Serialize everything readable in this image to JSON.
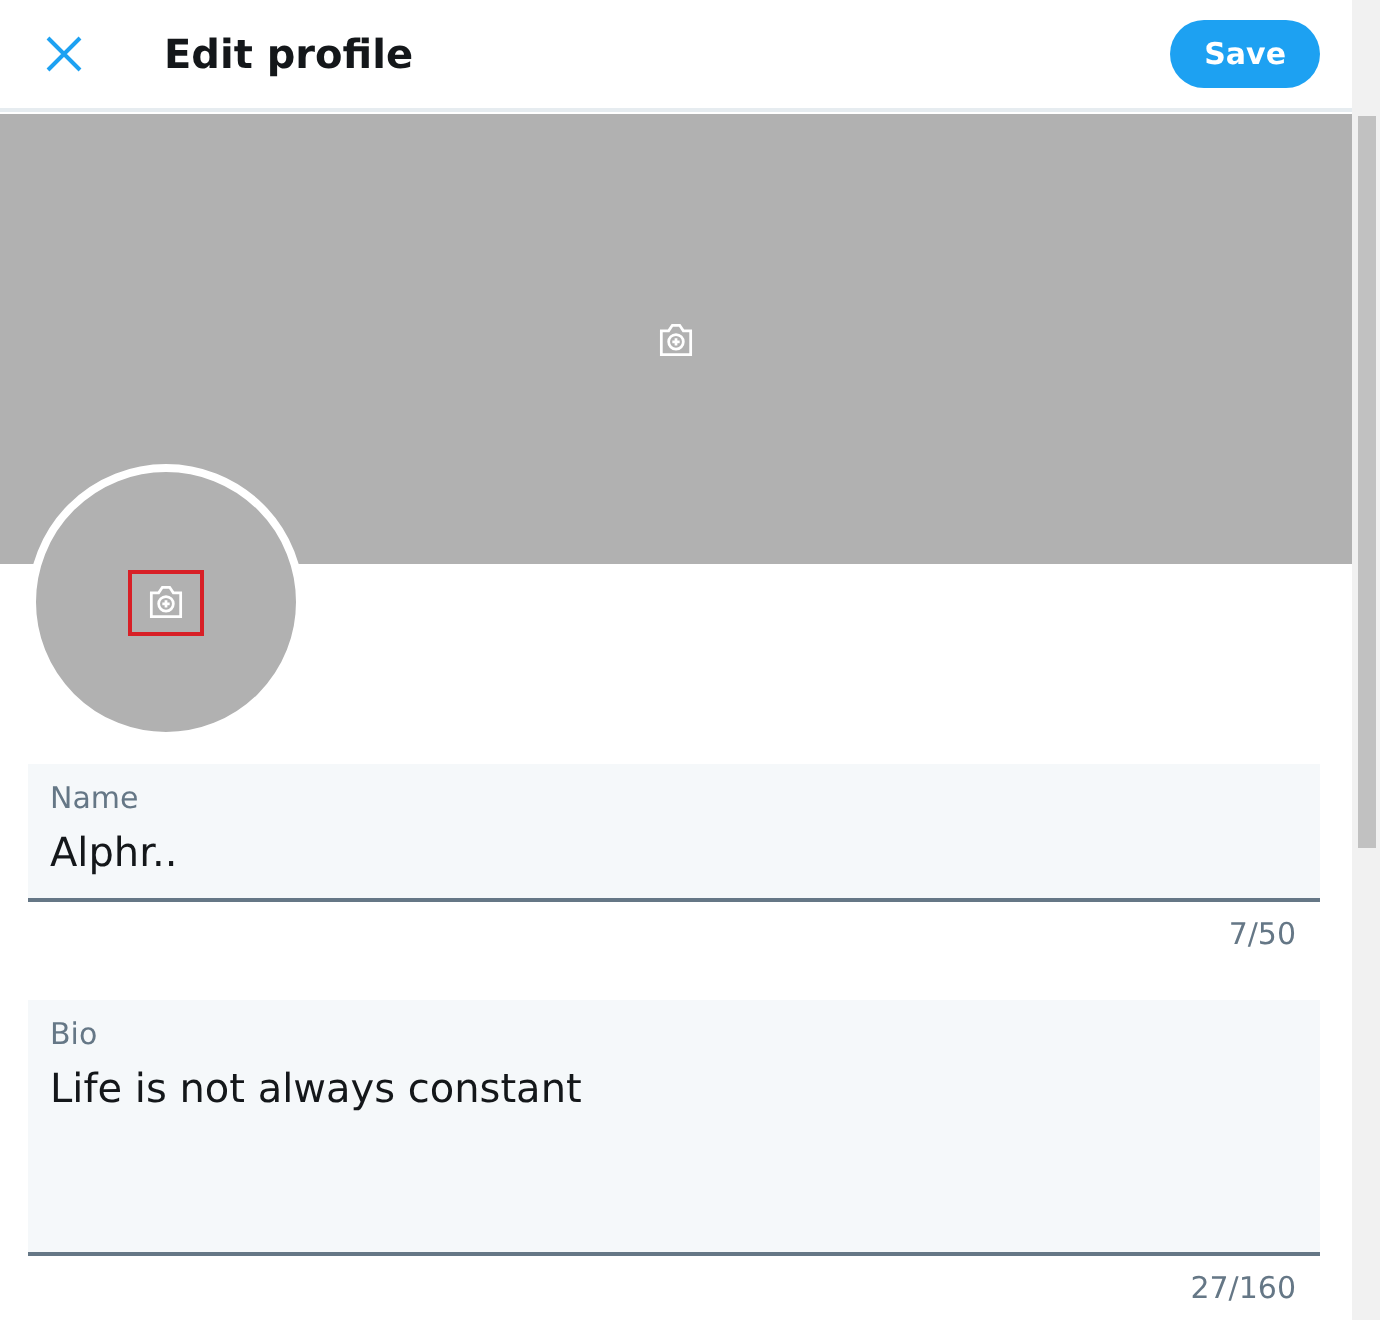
{
  "header": {
    "title": "Edit profile",
    "save_button": "Save"
  },
  "avatar": {
    "highlighted": true
  },
  "fields": [
    {
      "kind": "line",
      "label": "Name",
      "value": "Alphr..",
      "counter": "7/50"
    },
    {
      "kind": "area",
      "label": "Bio",
      "value": "Life is not always constant",
      "counter": "27/160"
    }
  ]
}
